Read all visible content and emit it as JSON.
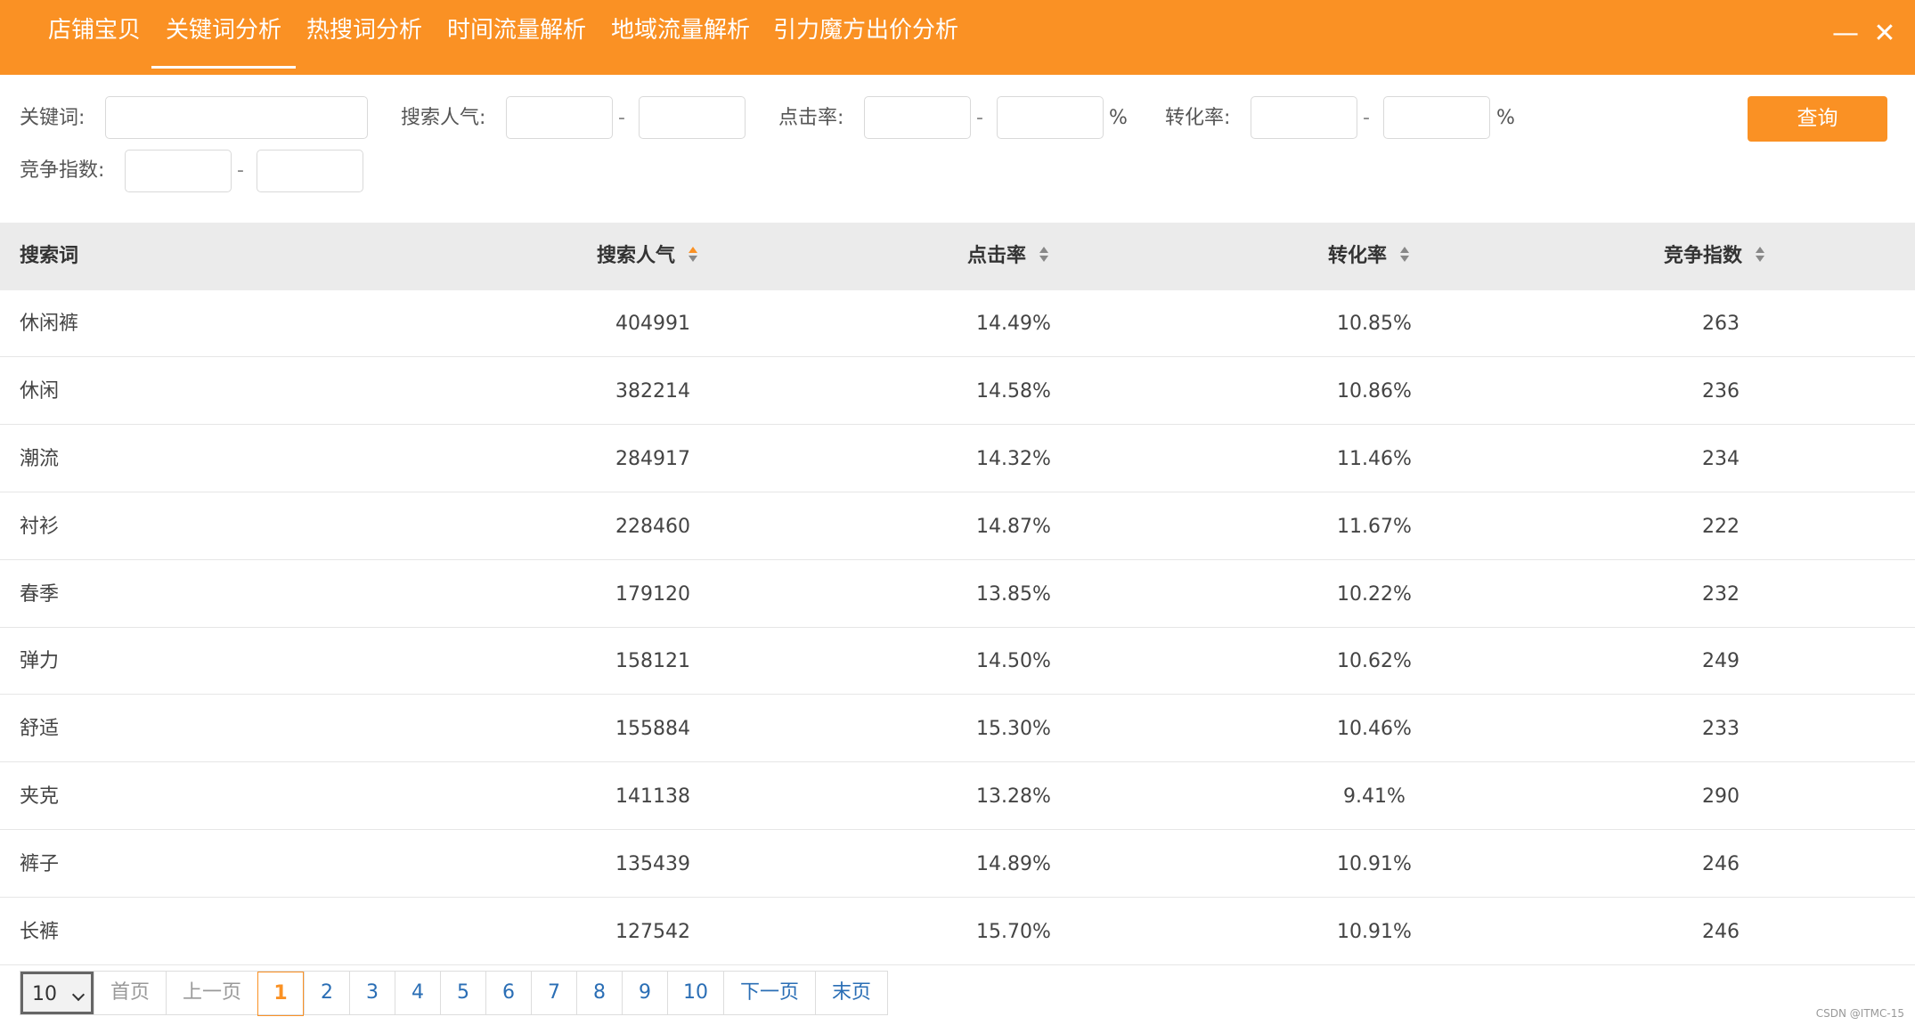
{
  "nav": {
    "tabs": [
      {
        "label": "店铺宝贝"
      },
      {
        "label": "关键词分析"
      },
      {
        "label": "热搜词分析"
      },
      {
        "label": "时间流量解析"
      },
      {
        "label": "地域流量解析"
      },
      {
        "label": "引力魔方出价分析"
      }
    ],
    "active_tab": "关键词分析",
    "minimize": "—",
    "close": "✕"
  },
  "filters": {
    "keyword_label": "关键词:",
    "popularity_label": "搜索人气:",
    "ctr_label": "点击率:",
    "cvr_label": "转化率:",
    "competition_label": "竞争指数:",
    "range_sep": "-",
    "percent": "%",
    "query_button": "查询"
  },
  "table": {
    "headers": [
      "搜索词",
      "搜索人气",
      "点击率",
      "转化率",
      "竞争指数"
    ],
    "rows": [
      [
        "休闲裤",
        "404991",
        "14.49%",
        "10.85%",
        "263"
      ],
      [
        "休闲",
        "382214",
        "14.58%",
        "10.86%",
        "236"
      ],
      [
        "潮流",
        "284917",
        "14.32%",
        "11.46%",
        "234"
      ],
      [
        "衬衫",
        "228460",
        "14.87%",
        "11.67%",
        "222"
      ],
      [
        "春季",
        "179120",
        "13.85%",
        "10.22%",
        "232"
      ],
      [
        "弹力",
        "158121",
        "14.50%",
        "10.62%",
        "249"
      ],
      [
        "舒适",
        "155884",
        "15.30%",
        "10.46%",
        "233"
      ],
      [
        "夹克",
        "141138",
        "13.28%",
        "9.41%",
        "290"
      ],
      [
        "裤子",
        "135439",
        "14.89%",
        "10.91%",
        "246"
      ],
      [
        "长裤",
        "127542",
        "15.70%",
        "10.91%",
        "246"
      ]
    ]
  },
  "pager": {
    "page_size": "10",
    "first": "首页",
    "prev": "上一页",
    "pages": [
      "1",
      "2",
      "3",
      "4",
      "5",
      "6",
      "7",
      "8",
      "9",
      "10"
    ],
    "current": "1",
    "next": "下一页",
    "last": "末页"
  },
  "watermark": "CSDN @ITMC-15",
  "colors": {
    "accent": "#fa9124",
    "link": "#2a6eb5",
    "header_bg": "#ebebeb"
  }
}
